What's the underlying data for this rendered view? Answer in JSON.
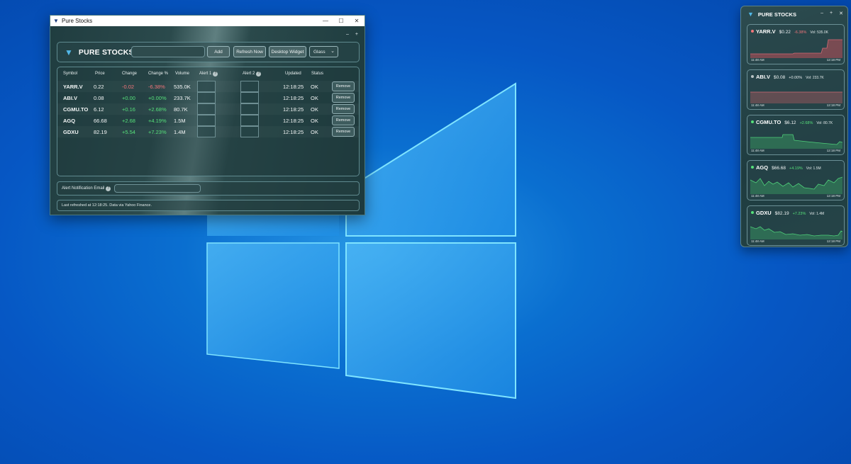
{
  "main_window": {
    "title": "Pure Stocks",
    "brand": "PURE STOCKS",
    "symbol_input_value": "",
    "buttons": {
      "add": "Add",
      "refresh": "Refresh Now",
      "widget": "Desktop Widget"
    },
    "theme_select": "Glass",
    "table": {
      "headers": [
        "Symbol",
        "Price",
        "Change",
        "Change %",
        "Volume",
        "Alert 1",
        "Alert 2",
        "Updated",
        "Status"
      ],
      "remove_label": "Remove",
      "rows": [
        {
          "symbol": "YARR.V",
          "price": "0.22",
          "change": "-0.02",
          "change_pct": "-6.38%",
          "volume": "535.0K",
          "updated": "12:18:25",
          "status": "OK"
        },
        {
          "symbol": "ABI.V",
          "price": "0.08",
          "change": "+0.00",
          "change_pct": "+0.00%",
          "volume": "233.7K",
          "updated": "12:18:25",
          "status": "OK"
        },
        {
          "symbol": "CGMU.TO",
          "price": "6.12",
          "change": "+0.16",
          "change_pct": "+2.68%",
          "volume": "80.7K",
          "updated": "12:18:25",
          "status": "OK"
        },
        {
          "symbol": "AGQ",
          "price": "66.68",
          "change": "+2.68",
          "change_pct": "+4.19%",
          "volume": "1.5M",
          "updated": "12:18:25",
          "status": "OK"
        },
        {
          "symbol": "GDXU",
          "price": "82.19",
          "change": "+5.54",
          "change_pct": "+7.23%",
          "volume": "1.4M",
          "updated": "12:18:25",
          "status": "OK"
        }
      ]
    },
    "email_label": "Alert Notification Email",
    "status_text": "Last refreshed at 12:18:25. Data via Yahoo Finance."
  },
  "widget": {
    "title": "PURE STOCKS",
    "cards": [
      {
        "symbol": "YARR.V",
        "price": "$0.22",
        "change_pct": "-6.38%",
        "volume": "Vol: 535.0K",
        "start_time": "11:48 AM",
        "end_time": "12:18 PM"
      },
      {
        "symbol": "ABI.V",
        "price": "$0.08",
        "change_pct": "+0.00%",
        "volume": "Vol: 233.7K",
        "start_time": "11:48 AM",
        "end_time": "12:18 PM"
      },
      {
        "symbol": "CGMU.TO",
        "price": "$6.12",
        "change_pct": "+2.68%",
        "volume": "Vol: 80.7K",
        "start_time": "11:48 AM",
        "end_time": "12:18 PM"
      },
      {
        "symbol": "AGQ",
        "price": "$66.68",
        "change_pct": "+4.19%",
        "volume": "Vol: 1.5M",
        "start_time": "11:48 AM",
        "end_time": "12:18 PM"
      },
      {
        "symbol": "GDXU",
        "price": "$82.19",
        "change_pct": "+7.23%",
        "volume": "Vol: 1.4M",
        "start_time": "11:48 AM",
        "end_time": "12:18 PM"
      }
    ]
  },
  "colors": {
    "positive": "#56e07a",
    "negative": "#f2757a",
    "neutral": "#b9c3c4",
    "accent": "#52b8e8"
  },
  "icons": [
    "pure-stocks-logo-icon",
    "help-icon",
    "chevron-down-icon",
    "minimize-icon",
    "maximize-icon",
    "close-icon",
    "status-dot-icon"
  ]
}
